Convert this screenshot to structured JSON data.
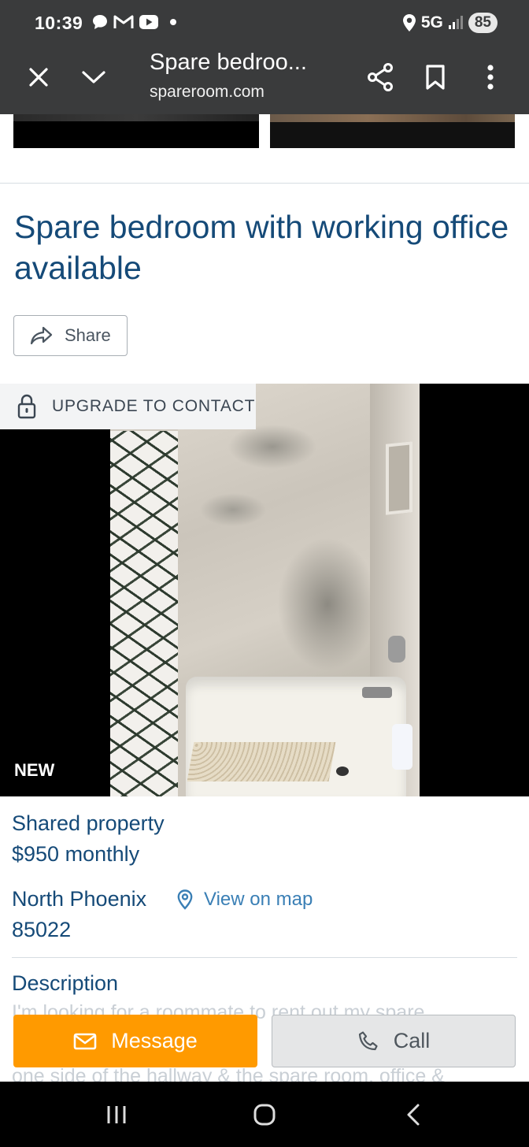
{
  "status_bar": {
    "time": "10:39",
    "network": "5G",
    "battery": "85",
    "notification_icons": [
      "chat-icon",
      "gmail-icon",
      "youtube-icon"
    ]
  },
  "tab": {
    "title": "Spare bedroo...",
    "domain": "spareroom.com"
  },
  "listing": {
    "title": "Spare bedroom with working office available",
    "share_label": "Share",
    "upgrade_label": "UPGRADE TO CONTACT",
    "badge": "NEW",
    "property_type": "Shared property",
    "price": "$950 monthly",
    "area": "North Phoenix",
    "map_label": "View on map",
    "zip": "85022",
    "description_label": "Description",
    "description_line1": "I'm looking for a roommate to rent out my spare",
    "description_line2": "one side of the hallway & the spare room, office &"
  },
  "actions": {
    "message_label": "Message",
    "call_label": "Call"
  },
  "colors": {
    "accent": "#ff9a00",
    "heading": "#154a78",
    "link": "#3a7fb5",
    "header_bg": "#3a3b3c"
  }
}
